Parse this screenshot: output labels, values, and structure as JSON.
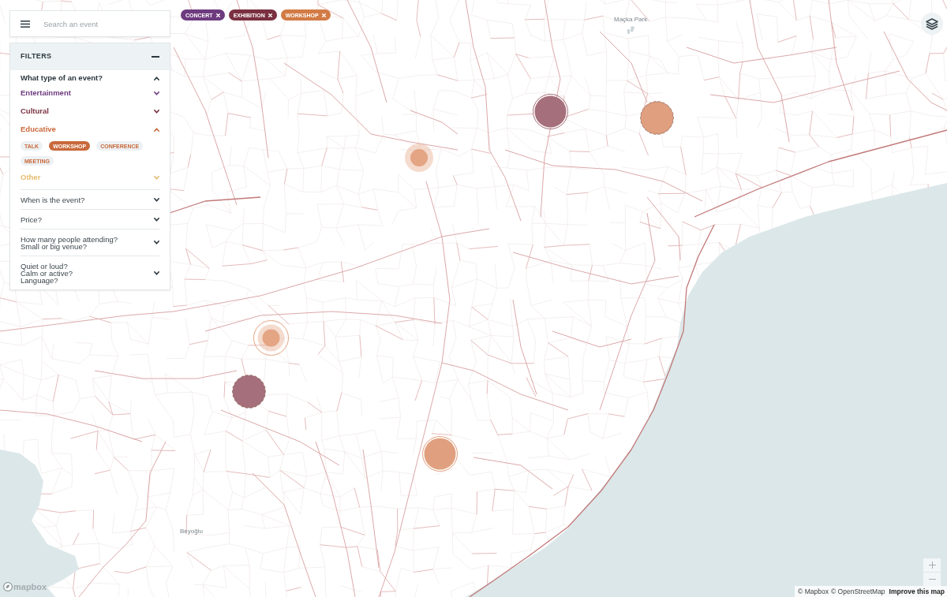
{
  "search": {
    "placeholder": "Search an event"
  },
  "active_tags": [
    {
      "label": "CONCERT",
      "color": "#6e3b7f"
    },
    {
      "label": "EXHIBITION",
      "color": "#7a3040"
    },
    {
      "label": "WORKSHOP",
      "color": "#d27b45"
    }
  ],
  "filters": {
    "title": "FILTERS",
    "expanded": true,
    "sections": [
      {
        "kind": "categories",
        "label": "What type of an event?",
        "expanded": true,
        "categories": [
          {
            "label": "Entertainment",
            "color": "#6e3b7f",
            "expanded": false
          },
          {
            "label": "Cultural",
            "color": "#7a3040",
            "expanded": false
          },
          {
            "label": "Educative",
            "color": "#c9693b",
            "expanded": true,
            "options": [
              {
                "label": "TALK",
                "selected": false
              },
              {
                "label": "WORKSHOP",
                "selected": true
              },
              {
                "label": "CONFERENCE",
                "selected": false
              },
              {
                "label": "MEETING",
                "selected": false
              }
            ]
          },
          {
            "label": "Other",
            "color": "#e8bb6e",
            "expanded": false
          }
        ]
      },
      {
        "kind": "question",
        "lines": [
          "When is the event?"
        ],
        "expanded": false
      },
      {
        "kind": "question",
        "lines": [
          "Price?"
        ],
        "expanded": false
      },
      {
        "kind": "question",
        "lines": [
          "How many people attending?",
          "Small or big venue?"
        ],
        "expanded": false
      },
      {
        "kind": "question",
        "lines": [
          "Quiet or loud?",
          "Calm or active?",
          "Language?"
        ],
        "expanded": false
      }
    ]
  },
  "map": {
    "place_labels": [
      {
        "label": "Maçka Park",
        "kind": "park"
      },
      {
        "label": "Beyoğlu",
        "kind": "district"
      }
    ],
    "markers": [
      {
        "kind": "ringed",
        "color": "#a5707b"
      },
      {
        "kind": "scalloped",
        "color": "#e0a07f"
      },
      {
        "kind": "halo",
        "color": "#e4a584"
      },
      {
        "kind": "halo-ringed",
        "color": "#e4a584"
      },
      {
        "kind": "scalloped",
        "color": "#a5707b"
      },
      {
        "kind": "ringed",
        "color": "#e0a07f"
      }
    ]
  },
  "attribution": {
    "logo": "mapbox",
    "links": [
      {
        "label": "© Mapbox",
        "kind": "credit"
      },
      {
        "label": "© OpenStreetMap",
        "kind": "credit"
      },
      {
        "label": "Improve this map",
        "kind": "action"
      }
    ]
  }
}
